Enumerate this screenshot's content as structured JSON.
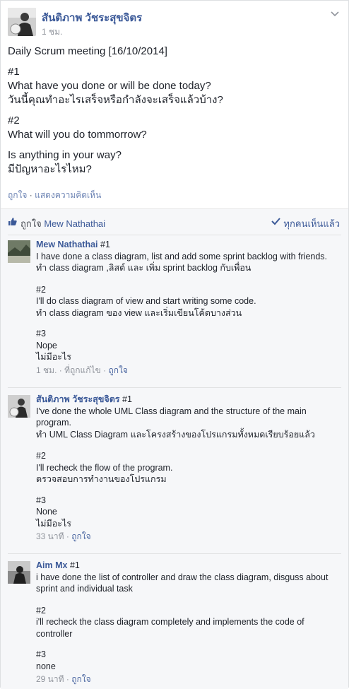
{
  "post": {
    "author": "สันติภาพ วัชระสุขจิตร",
    "time": "1 ชม.",
    "lines": [
      [
        "Daily Scrum meeting [16/10/2014]"
      ],
      [
        "#1",
        "What have you done or will be done today?",
        "วันนี้คุณทำอะไรเสร็จหรือกำลังจะเสร็จแล้วบ้าง?"
      ],
      [
        "#2",
        "What will you do tommorrow?"
      ],
      [
        "Is anything in your way?",
        "มีปัญหาอะไรไหม?"
      ]
    ],
    "like_label": "ถูกใจ",
    "comment_label": "แสดงความคิดเห็น",
    "separator": "·"
  },
  "ufi": {
    "like_word": "ถูกใจ",
    "liker": "Mew Nathathai",
    "seen_label": "ทุกคนเห็นแล้ว"
  },
  "comments": [
    {
      "name": "Mew Nathathai",
      "first_tag": "#1",
      "lines": [
        "I have done a class diagram, list and add some sprint backlog with friends.",
        "ทำ class diagram ,ลิสต์ และ เพิ่ม sprint backlog กับเพื่อน"
      ],
      "blocks": [
        [
          "#2",
          "I'll do class diagram of view and start writing some code.",
          "ทำ class diagram ของ view และเริ่มเขียนโค้ดบางส่วน"
        ],
        [
          "#3",
          "Nope",
          "ไม่มีอะไร"
        ]
      ],
      "time": "1 ชม.",
      "edited": "ที่ถูกแก้ไข",
      "like": "ถูกใจ"
    },
    {
      "name": "สันติภาพ วัชระสุขจิตร",
      "first_tag": "#1",
      "lines": [
        "I've done the whole UML Class diagram and the structure of the main program.",
        "ทำ UML Class Diagram และโครงสร้างของโปรแกรมทั้งหมดเรียบร้อยแล้ว"
      ],
      "blocks": [
        [
          "#2",
          "I'll recheck the flow of the program.",
          "ตรวจสอบการทำงานของโปรแกรม"
        ],
        [
          "#3",
          "None",
          "ไม่มีอะไร"
        ]
      ],
      "time": "33 นาที",
      "like": "ถูกใจ"
    },
    {
      "name": "Aim Mx",
      "first_tag": "#1",
      "lines": [
        "i have done the list of controller and draw the class diagram, disguss about sprint and individual task"
      ],
      "blocks": [
        [
          "#2",
          "i'll recheck the class diagram completely and implements the code of controller"
        ],
        [
          "#3",
          "none"
        ]
      ],
      "time": "29 นาที",
      "like": "ถูกใจ"
    }
  ]
}
